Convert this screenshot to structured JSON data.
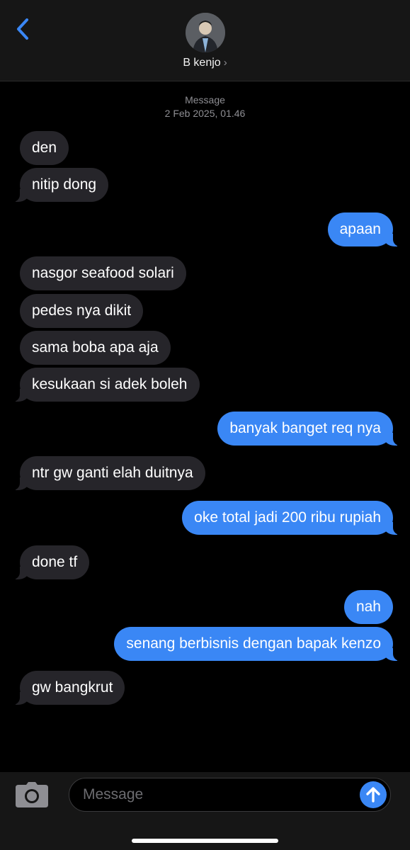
{
  "header": {
    "back_icon": "chevron-left-icon",
    "contact_name": "B kenjo",
    "contact_chevron": "›",
    "avatar": "contact-photo"
  },
  "thread": {
    "service_label": "Message",
    "timestamp": "2 Feb 2025, 01.46",
    "messages": [
      {
        "from": "them",
        "text": "den"
      },
      {
        "from": "them",
        "text": "nitip dong"
      },
      {
        "from": "me",
        "text": "apaan"
      },
      {
        "from": "them",
        "text": "nasgor seafood solari"
      },
      {
        "from": "them",
        "text": "pedes nya dikit"
      },
      {
        "from": "them",
        "text": "sama boba apa aja"
      },
      {
        "from": "them",
        "text": "kesukaan si adek boleh"
      },
      {
        "from": "me",
        "text": "banyak banget req nya"
      },
      {
        "from": "them",
        "text": "ntr gw ganti elah duitnya"
      },
      {
        "from": "me",
        "text": "oke total jadi 200 ribu rupiah"
      },
      {
        "from": "them",
        "text": "done tf"
      },
      {
        "from": "me",
        "text": "nah"
      },
      {
        "from": "me",
        "text": "senang berbisnis dengan bapak kenzo"
      },
      {
        "from": "them",
        "text": "gw bangkrut"
      }
    ]
  },
  "composer": {
    "camera_icon": "camera-icon",
    "placeholder": "Message",
    "send_icon": "arrow-up-icon"
  },
  "colors": {
    "accent": "#3a87f5",
    "incoming_bubble": "#26252a",
    "background": "#000000",
    "header": "#161616"
  }
}
